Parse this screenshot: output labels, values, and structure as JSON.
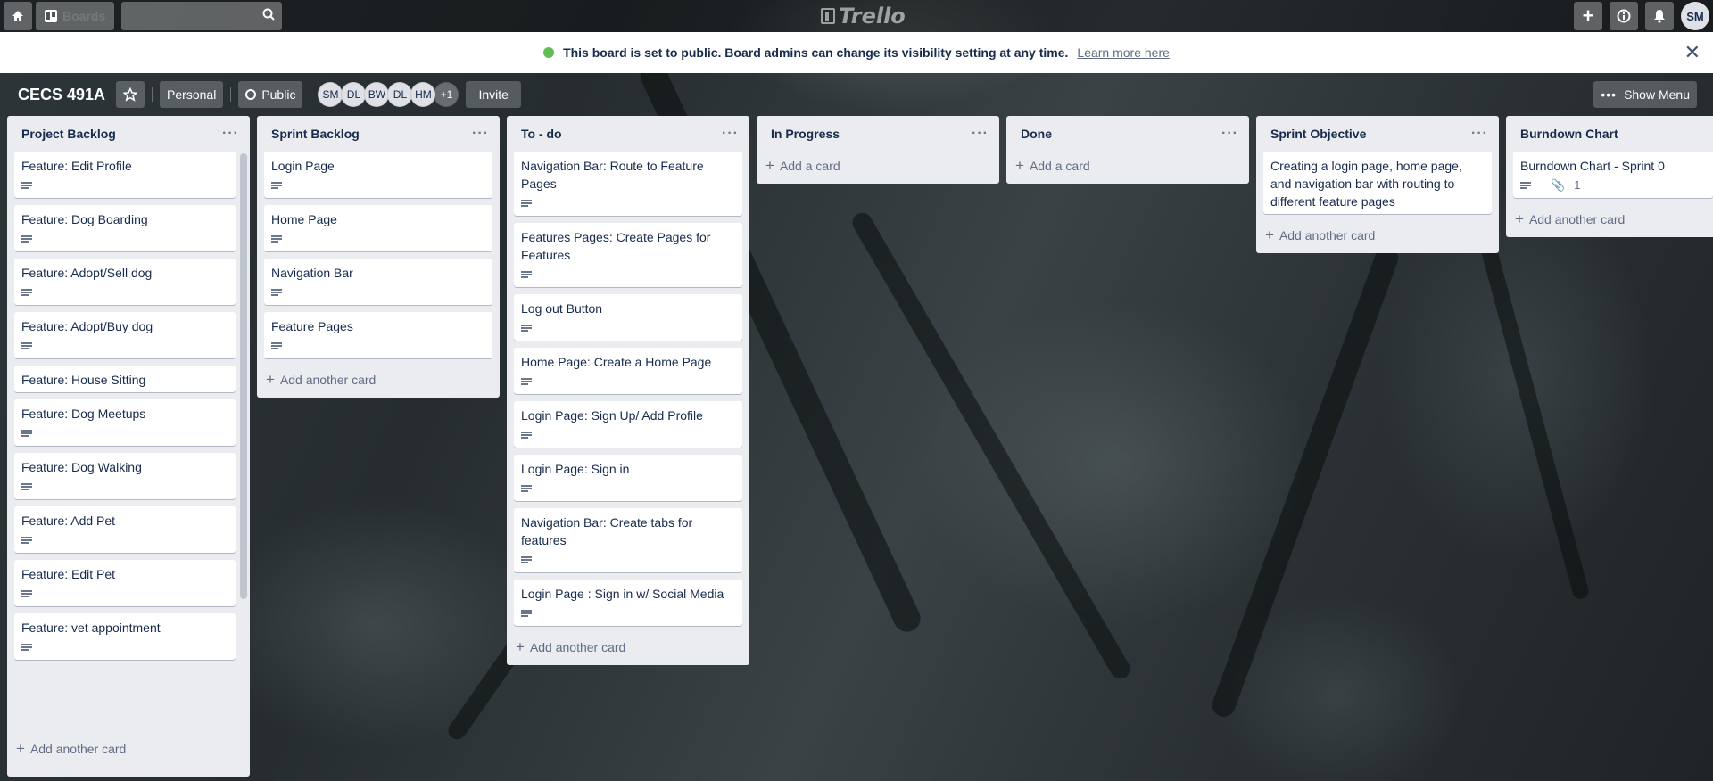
{
  "header": {
    "boards_label": "Boards",
    "search_placeholder": "",
    "logo_text": "Trello",
    "avatar": "SM"
  },
  "banner": {
    "message": "This board is set to public. Board admins can change its visibility setting at any time.",
    "learn_more": "Learn more here"
  },
  "board": {
    "title": "CECS 491A",
    "team": "Personal",
    "visibility": "Public",
    "members": [
      "SM",
      "DL",
      "BW",
      "DL",
      "HM",
      "+1"
    ],
    "invite": "Invite",
    "show_menu": "Show Menu"
  },
  "lists": [
    {
      "title": "Project Backlog",
      "add_label": "Add another card",
      "cards": [
        {
          "title": "Feature: Edit Profile"
        },
        {
          "title": "Feature: Dog Boarding"
        },
        {
          "title": "Feature: Adopt/Sell dog"
        },
        {
          "title": "Feature: Adopt/Buy dog"
        },
        {
          "title": "Feature: House Sitting"
        },
        {
          "title": "Feature: Dog Meetups"
        },
        {
          "title": "Feature: Dog Walking"
        },
        {
          "title": "Feature: Add Pet"
        },
        {
          "title": "Feature: Edit Pet"
        },
        {
          "title": "Feature: vet appointment"
        }
      ]
    },
    {
      "title": "Sprint Backlog",
      "add_label": "Add another card",
      "cards": [
        {
          "title": "Login Page"
        },
        {
          "title": "Home Page"
        },
        {
          "title": "Navigation Bar"
        },
        {
          "title": "Feature Pages"
        }
      ]
    },
    {
      "title": "To - do",
      "add_label": "Add another card",
      "cards": [
        {
          "title": "Navigation Bar: Route to Feature Pages"
        },
        {
          "title": "Features Pages: Create Pages for Features"
        },
        {
          "title": "Log out Button"
        },
        {
          "title": "Home Page: Create a Home Page"
        },
        {
          "title": "Login Page: Sign Up/ Add Profile"
        },
        {
          "title": "Login Page: Sign in"
        },
        {
          "title": "Navigation Bar: Create tabs for features"
        },
        {
          "title": "Login Page : Sign in w/ Social Media"
        }
      ]
    },
    {
      "title": "In Progress",
      "add_label": "Add a card",
      "cards": []
    },
    {
      "title": "Done",
      "add_label": "Add a card",
      "cards": []
    },
    {
      "title": "Sprint Objective",
      "add_label": "Add another card",
      "cards": [
        {
          "title": "Creating a login page, home page, and navigation bar with routing to different feature pages"
        }
      ]
    },
    {
      "title": "Burndown Chart",
      "add_label": "Add another card",
      "cards": [
        {
          "title": "Burndown Chart - Sprint 0",
          "attachments": "1"
        }
      ]
    }
  ]
}
